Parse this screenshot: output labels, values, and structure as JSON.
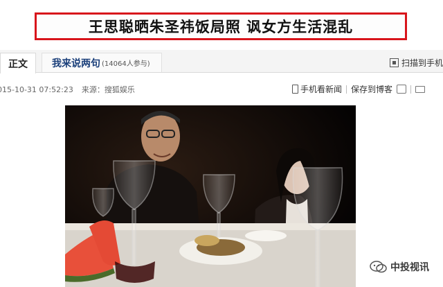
{
  "headline": "王思聪晒朱圣祎饭局照  讽女方生活混乱",
  "tabs": {
    "main": "正文",
    "comments_label": "我来说两句",
    "comments_count": "(14064人参与)"
  },
  "scan_to_phone": "扫描到手机",
  "meta": {
    "datetime": "015-10-31 07:52:23",
    "source": "来源：搜狐娱乐"
  },
  "actions": {
    "mobile_news": "手机看新闻",
    "save_to_blog": "保存到博客"
  },
  "watermark": "中投视讯",
  "colors": {
    "headline_border": "#d8141b",
    "tab_link": "#1a3f7a"
  }
}
